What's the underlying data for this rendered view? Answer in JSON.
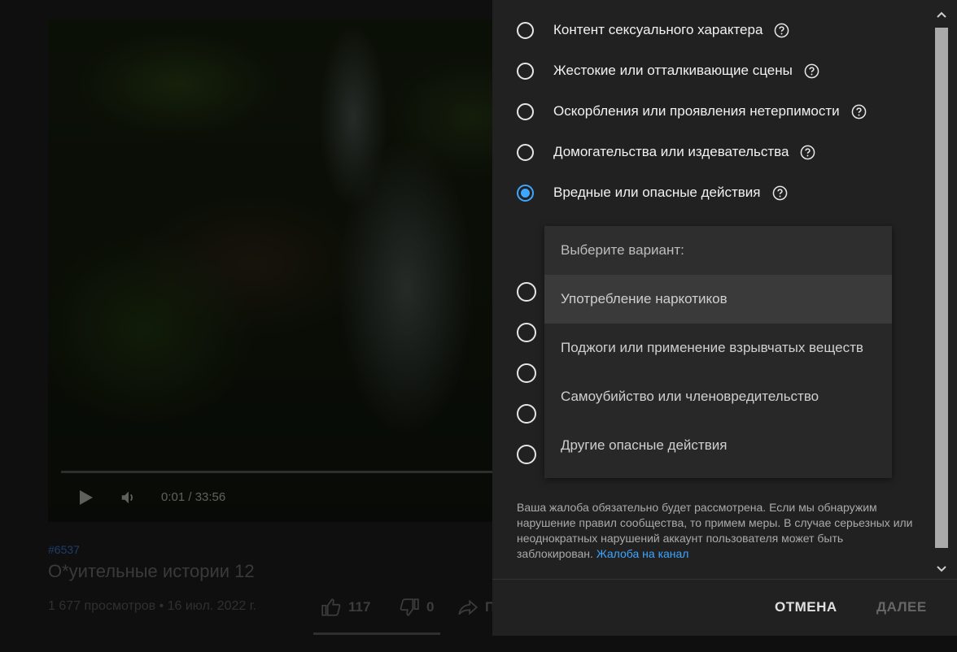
{
  "video": {
    "time": "0:01 / 33:56",
    "hashtag": "#6537",
    "title": "О*уительные истории 12",
    "views_date": "1 677 просмотров • 16 июл. 2022 г.",
    "likes": "117",
    "dislikes": "0",
    "share_label": "П"
  },
  "report": {
    "options": [
      {
        "label": "Контент сексуального характера",
        "checked": false
      },
      {
        "label": "Жестокие или отталкивающие сцены",
        "checked": false
      },
      {
        "label": "Оскорбления или проявления нетерпимости",
        "checked": false
      },
      {
        "label": "Домогательства или издевательства",
        "checked": false
      },
      {
        "label": "Вредные или опасные действия",
        "checked": true
      }
    ],
    "dropdown": {
      "header": "Выберите вариант:",
      "items": [
        "Употребление наркотиков",
        "Поджоги или применение взрывчатых веществ",
        "Самоубийство или членовредительство",
        "Другие опасные действия"
      ],
      "highlighted_index": 0
    },
    "notice_text": "Ваша жалоба обязательно будет рассмотрена. Если мы обнаружим нарушение правил сообщества, то примем меры. В случае серьезных или неоднократных нарушений аккаунт пользователя может быть заблокирован.",
    "notice_link": "Жалоба на канал",
    "cancel_label": "ОТМЕНА",
    "next_label": "ДАЛЕЕ"
  },
  "colors": {
    "accent": "#3ea6ff",
    "dialog_bg": "#212121",
    "page_bg": "#0f0f0f"
  }
}
